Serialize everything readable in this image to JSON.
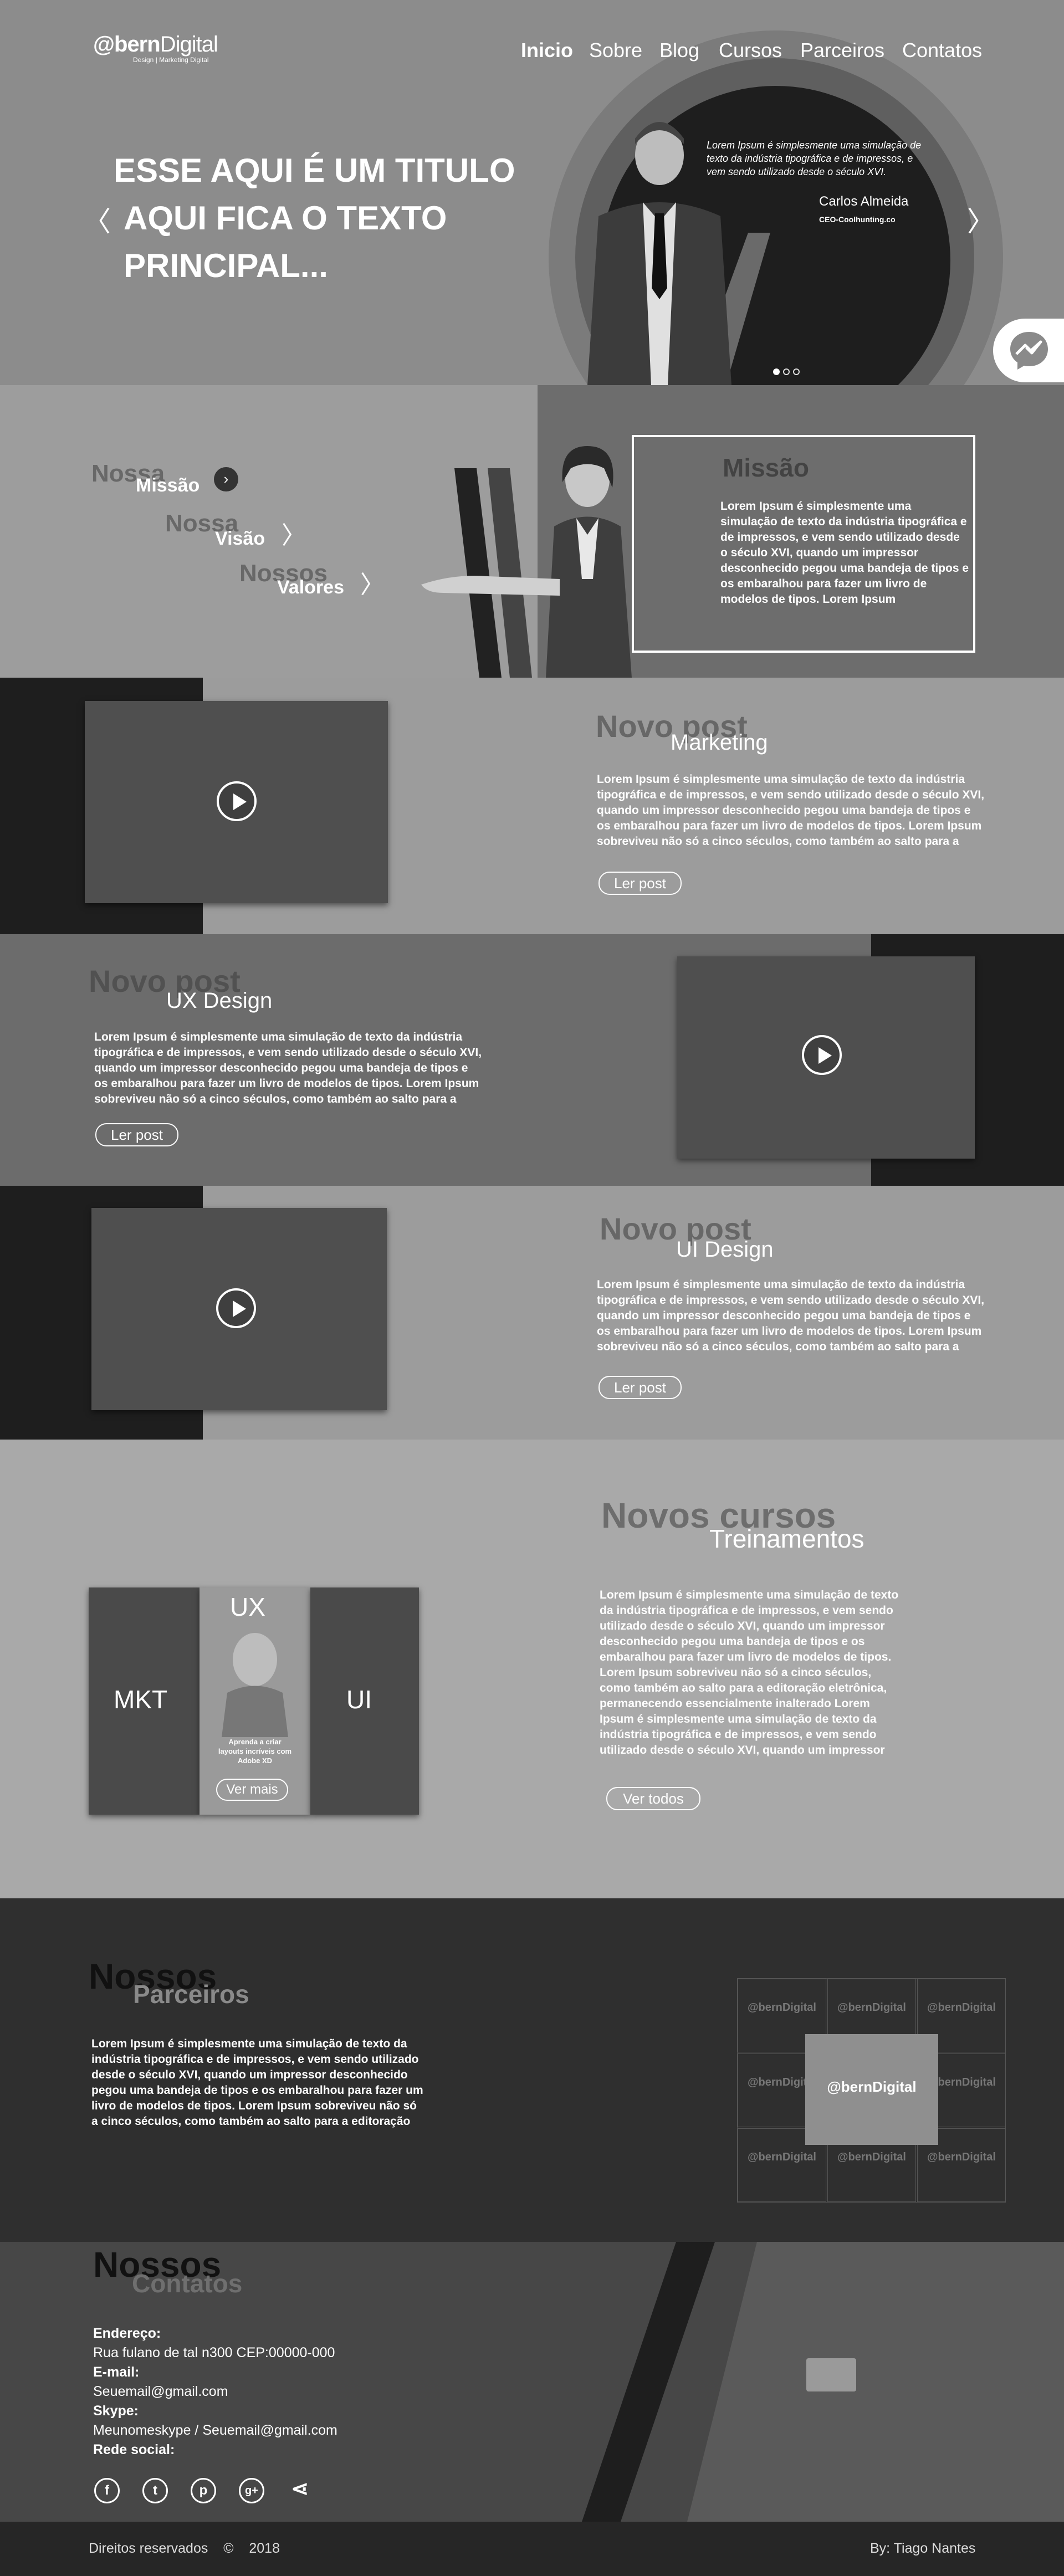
{
  "brand": {
    "logo_bold": "@bern",
    "logo_light": "Digital",
    "tagline": "Design | Marketing Digital"
  },
  "nav": {
    "items": [
      "Inicio",
      "Sobre",
      "Blog",
      "Cursos",
      "Parceiros",
      "Contatos"
    ]
  },
  "hero": {
    "title_lines": [
      "ESSE AQUI É UM TITULO",
      "AQUI FICA O TEXTO",
      "PRINCIPAL..."
    ],
    "quote": "Lorem Ipsum é simplesmente uma simulação de texto da indústria tipográfica e de impressos, e vem sendo utilizado desde o século XVI.",
    "name": "Carlos Almeida",
    "role": "CEO-Coolhunting.co",
    "prev_glyph": "〈",
    "next_glyph": "〉"
  },
  "mission": {
    "tabs": [
      {
        "ghost": "Nossa",
        "label": "Missão"
      },
      {
        "ghost": "Nossa",
        "label": "Visão"
      },
      {
        "ghost": "Nossos",
        "label": "Valores"
      }
    ],
    "box_title": "Missão",
    "box_text": "Lorem Ipsum é simplesmente uma simulação de texto da indústria tipográfica e de impressos, e vem sendo utilizado desde o século XVI, quando um impressor desconhecido pegou uma bandeja de tipos e os embaralhou para fazer um livro de modelos de tipos. Lorem Ipsum"
  },
  "posts": [
    {
      "ghost": "Novo post",
      "title": "Marketing",
      "text": "Lorem Ipsum é simplesmente uma simulação de texto da indústria tipográfica e de impressos, e vem sendo utilizado desde o século XVI, quando um impressor desconhecido pegou uma bandeja de tipos e os embaralhou para fazer um livro de modelos de tipos. Lorem Ipsum sobreviveu não só a cinco séculos, como também ao salto para a",
      "button": "Ler post"
    },
    {
      "ghost": "Novo post",
      "title": "UX Design",
      "text": "Lorem Ipsum é simplesmente uma simulação de texto da indústria tipográfica e de impressos, e vem sendo utilizado desde o século XVI, quando um impressor desconhecido pegou uma bandeja de tipos e os embaralhou para fazer um livro de modelos de tipos. Lorem Ipsum sobreviveu não só a cinco séculos, como também ao salto para a",
      "button": "Ler post"
    },
    {
      "ghost": "Novo post",
      "title": "UI Design",
      "text": "Lorem Ipsum é simplesmente uma simulação de texto da indústria tipográfica e de impressos, e vem sendo utilizado desde o século XVI, quando um impressor desconhecido pegou uma bandeja de tipos e os embaralhou para fazer um livro de modelos de tipos. Lorem Ipsum sobreviveu não só a cinco séculos, como também ao salto para a",
      "button": "Ler post"
    }
  ],
  "courses": {
    "ghost": "Novos cursos",
    "title": "Treinamentos",
    "text": "Lorem Ipsum é simplesmente uma simulação de texto da indústria tipográfica e de impressos, e vem sendo utilizado desde o século XVI, quando um impressor desconhecido pegou uma bandeja de tipos e os embaralhou para fazer um livro de modelos de tipos. Lorem Ipsum sobreviveu não só a cinco séculos, como também ao salto para a editoração eletrônica, permanecendo essencialmente inalterado Lorem Ipsum é simplesmente uma simulação de texto da indústria tipográfica e de impressos, e vem sendo utilizado desde o século XVI, quando um impressor",
    "cards": [
      "MKT",
      "UX",
      "UI"
    ],
    "card_caption": "Aprenda a criar layouts incríveis com Adobe XD",
    "card_button": "Ver mais",
    "all_button": "Ver todos"
  },
  "partners": {
    "ghost": "Nossos",
    "title": "Parceiros",
    "text": "Lorem Ipsum é simplesmente uma simulação de texto da indústria tipográfica e de impressos, e vem sendo utilizado desde o século XVI, quando um impressor desconhecido pegou uma bandeja de tipos e os embaralhou para fazer um livro de modelos de tipos. Lorem Ipsum sobreviveu não só a cinco séculos, como também ao salto para a editoração",
    "logo_text": "@bernDigital"
  },
  "contacts": {
    "ghost": "Nossos",
    "title": "Contatos",
    "address_label": "Endereço:",
    "address": "Rua fulano de tal n300 CEP:00000-000",
    "email_label": "E-mail:",
    "email": "Seuemail@gmail.com",
    "skype_label": "Skype:",
    "skype": "Meunomeskype / Seuemail@gmail.com",
    "social_label": "Rede social:",
    "icons": [
      {
        "name": "facebook-icon",
        "glyph": "f"
      },
      {
        "name": "twitter-icon",
        "glyph": "t"
      },
      {
        "name": "pinterest-icon",
        "glyph": "p"
      },
      {
        "name": "googleplus-icon",
        "glyph": "g+"
      },
      {
        "name": "share-icon",
        "glyph": "⋖"
      }
    ]
  },
  "footer": {
    "rights": "Direitos reservados",
    "copyright": "©",
    "year": "2018",
    "author": "By: Tiago Nantes"
  }
}
